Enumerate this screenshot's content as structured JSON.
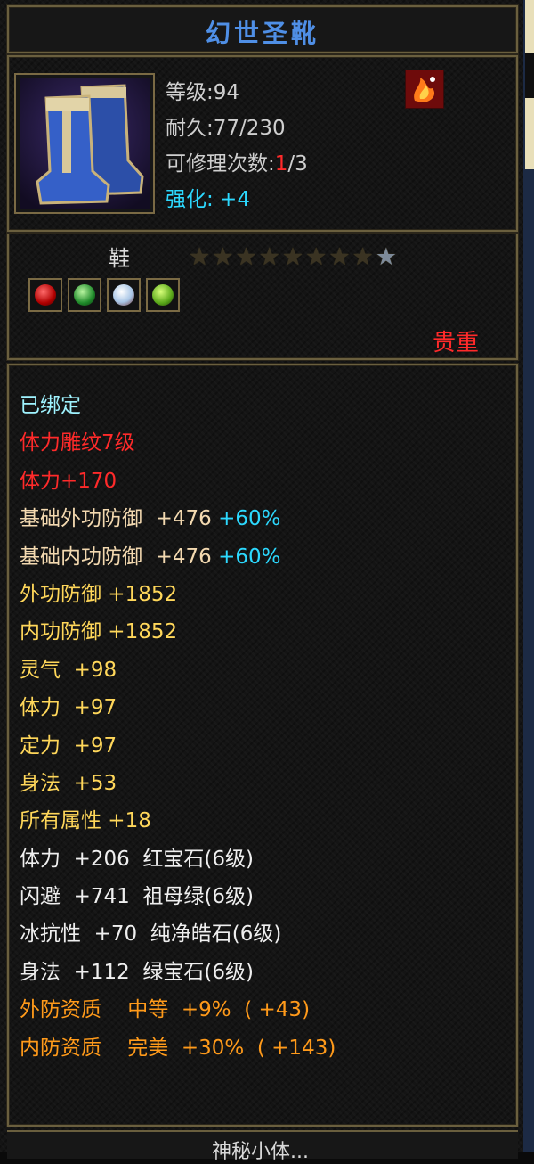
{
  "item": {
    "name": "幻世圣靴",
    "level_label": "等级:94",
    "durability_label": "耐久:77/230",
    "repair_prefix": "可修理次数:",
    "repair_used": "1",
    "repair_total": "/3",
    "enhance_label": "强化: +4",
    "slot": "鞋",
    "stars_total": 9,
    "stars_lit": 1,
    "rarity": "贵重",
    "icon": "boots-icon",
    "badge_icon": "fire-emblem-icon"
  },
  "gems": [
    "red-gem-icon",
    "green-gem-icon",
    "white-gem-icon",
    "jade-gem-icon"
  ],
  "attributes": {
    "bound": "已绑定",
    "engrave": "体力雕纹7级",
    "engrave_bonus": "体力+170",
    "base_outer_label": "基础外功防御  +476 ",
    "base_outer_pct": "+60%",
    "base_inner_label": "基础内功防御  +476 ",
    "base_inner_pct": "+60%",
    "outer_def": "外功防御 +1852",
    "inner_def": "内功防御 +1852",
    "spirit": "灵气  +98",
    "stamina": "体力  +97",
    "focus": "定力  +97",
    "agility": "身法  +53",
    "all_attr": "所有属性 +18",
    "gem1": "体力  +206  红宝石(6级)",
    "gem2": "闪避  +741  祖母绿(6级)",
    "gem3": "冰抗性  +70  纯净皓石(6级)",
    "gem4": "身法  +112  绿宝石(6级)",
    "aptitude_outer": "外防资质    中等  +9%  ( +43)",
    "aptitude_inner": "内防资质    完美  +30%  ( +143)"
  },
  "footer": {
    "text": "神秘小体..."
  },
  "colors": {
    "title": "#4f8fe6",
    "cyan": "#2cd9ff",
    "red": "#ff2a2a",
    "tan": "#f3d9b0",
    "yellow": "#ffd75a",
    "orange": "#ff9a1a"
  }
}
